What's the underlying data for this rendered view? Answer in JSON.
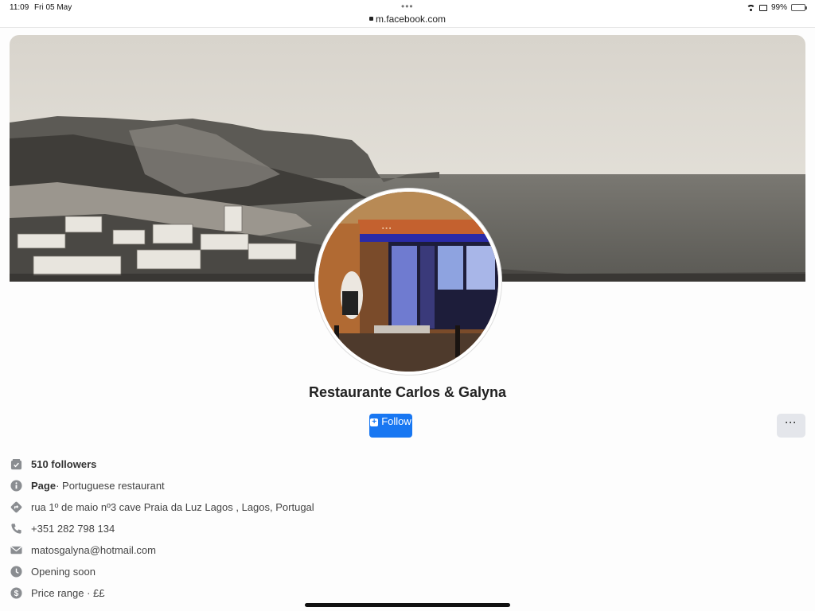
{
  "status_bar": {
    "time": "11:09",
    "date": "Fri 05 May",
    "url": "m.facebook.com",
    "battery": "99%",
    "battery_level": 0.99,
    "battery_color": "#34c759"
  },
  "icons": {
    "cover": "vintage-coastline-photo",
    "avatar": "restaurant-storefront-photo",
    "follow": "follow-plus-icon",
    "more": "ellipsis-icon"
  },
  "page": {
    "title": "Restaurante Carlos & Galyna",
    "follow_label": "Follow",
    "more_label": "···"
  },
  "info": {
    "followers": "510 followers",
    "page_label": "Page",
    "category": " · Portuguese restaurant",
    "address": "rua 1º de maio nº3 cave Praia da Luz Lagos , Lagos, Portugal",
    "phone": "+351 282 798 134",
    "email": "matosgalyna@hotmail.com",
    "hours": "Opening soon",
    "price": "Price range · ££"
  },
  "colors": {
    "accent": "#1877f2",
    "icon": "#8a8d91"
  }
}
